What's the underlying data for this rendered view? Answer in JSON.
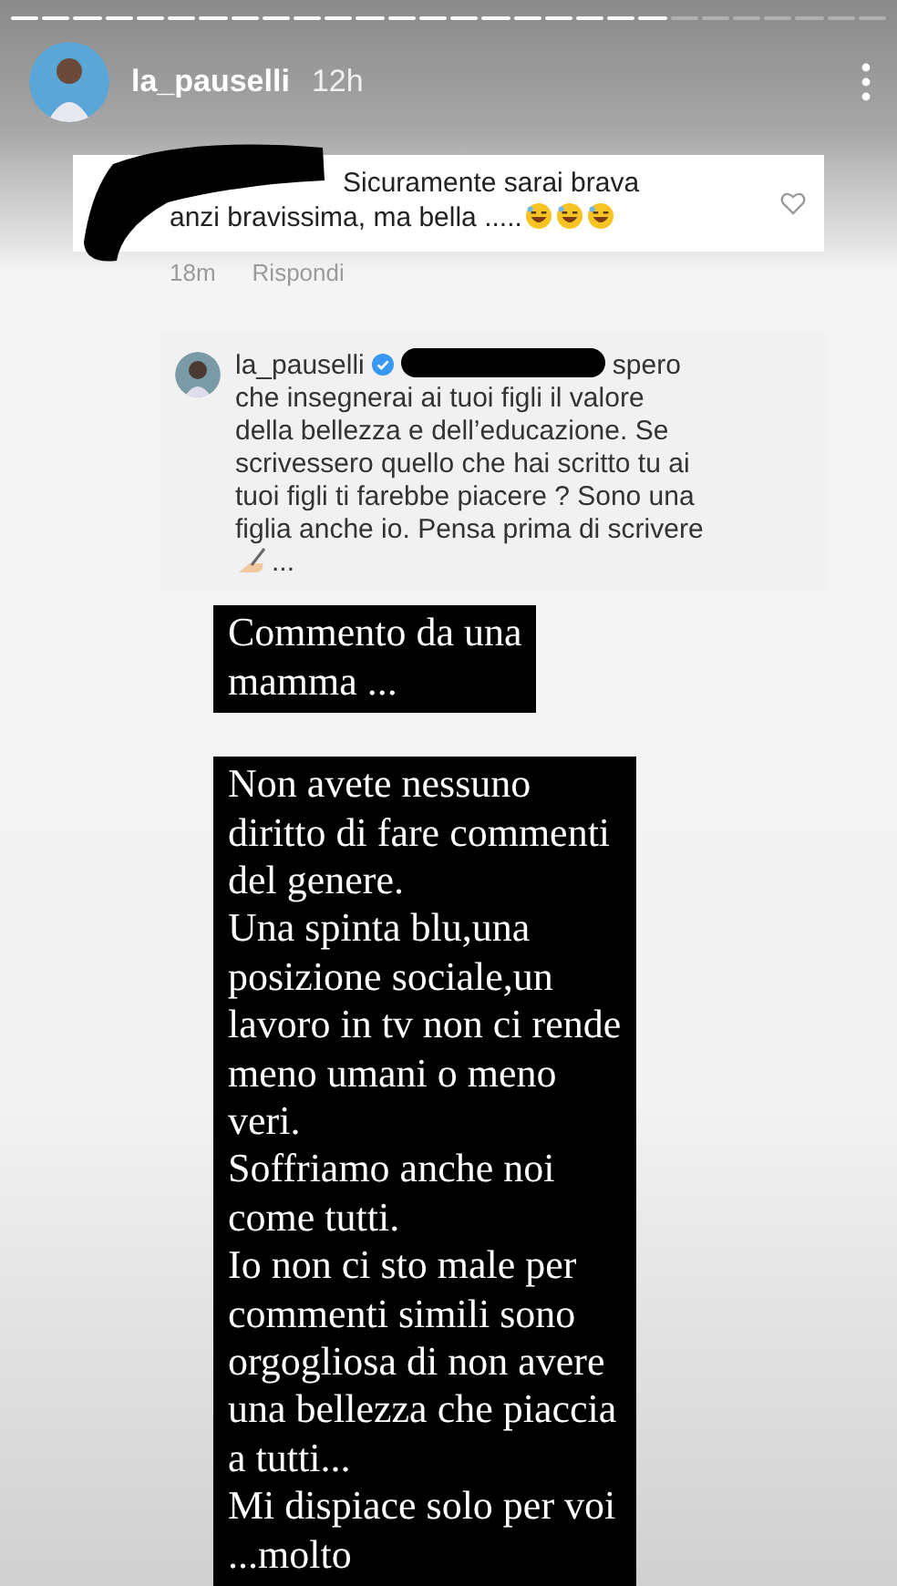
{
  "story_progress": [
    {
      "viewed": true
    },
    {
      "viewed": true
    },
    {
      "viewed": true
    },
    {
      "viewed": true
    },
    {
      "viewed": true
    },
    {
      "viewed": true
    },
    {
      "viewed": true
    },
    {
      "viewed": true
    },
    {
      "viewed": true
    },
    {
      "viewed": true
    },
    {
      "viewed": true
    },
    {
      "viewed": true
    },
    {
      "viewed": true
    },
    {
      "viewed": true
    },
    {
      "viewed": true
    },
    {
      "viewed": true
    },
    {
      "viewed": true
    },
    {
      "viewed": true
    },
    {
      "viewed": true
    },
    {
      "viewed": true
    },
    {
      "viewed": true
    },
    {
      "viewed": false
    },
    {
      "viewed": false
    },
    {
      "viewed": false
    },
    {
      "viewed": false
    },
    {
      "viewed": false
    },
    {
      "viewed": false
    },
    {
      "viewed": false
    }
  ],
  "header": {
    "username": "la_pauselli",
    "time": "12h"
  },
  "comment": {
    "text": "Sicuramente sarai brava anzi bravissima, ma bella .....",
    "emojis": [
      {
        "kind": "laughing"
      },
      {
        "kind": "laughing"
      },
      {
        "kind": "laughing"
      }
    ],
    "time": "18m",
    "reply_label": "Rispondi",
    "liked": false
  },
  "reply": {
    "username": "la_pauselli",
    "verified": true,
    "text": "spero che insegnerai ai tuoi figli il valore della bellezza e dell’educazione. Se scrivessero quello che hai scritto tu ai tuoi figli ti farebbe piacere ? Sono una figlia anche io. Pensa prima di scrivere",
    "ending": "..."
  },
  "text_blocks": [
    {
      "lines": [
        "Commento da una",
        "mamma ..."
      ]
    },
    {
      "lines": [
        "Non avete nessuno",
        "diritto di fare commenti",
        "del genere.",
        "Una spinta blu,una",
        "posizione sociale,un",
        "lavoro in tv non ci rende",
        "meno umani o meno",
        "veri.",
        "Soffriamo anche noi",
        "come tutti.",
        "Io non ci sto male per",
        "commenti simili sono",
        "orgogliosa di non avere",
        "una bellezza che piaccia",
        "a tutti...",
        "Mi dispiace solo per voi",
        "...molto"
      ]
    }
  ]
}
